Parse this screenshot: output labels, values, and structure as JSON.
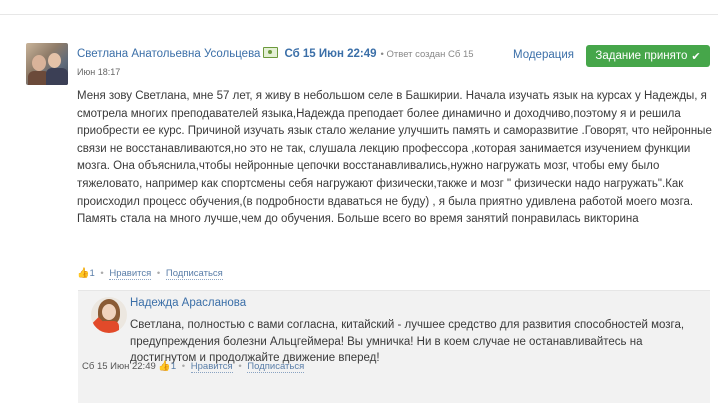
{
  "post": {
    "author": "Светлана Анатольевна Усольцева",
    "date": "Сб 15 Июн 22:49",
    "reply_note": "• Ответ создан Сб 15",
    "time": "Июн 18:17",
    "moderation_label": "Модерация",
    "accepted_label": "Задание принято",
    "text": "Меня зову Светлана, мне 57 лет, я живу в небольшом селе в Башкирии. Начала изучать язык на курсах у Надежды, я смотрела многих преподавателей языка,Надежда преподает более динамично и доходчиво,поэтому я и решила приобрести ее курс. Причиной изучать язык стало желание улучшить память и саморазвитие .Говорят, что нейронные связи не восстанавливаются,но это не так, слушала лекцию профессора ,которая занимается изучением функции мозга. Она объяснила,чтобы нейронные цепочки восстанавливались,нужно нагружать мозг, чтобы ему было тяжеловато, например как спортсмены себя нагружают физически,также и мозг \" физически надо нагружать\".Как происходил процесс обучения,(в подробности вдаваться не буду) , я была приятно удивлена работой моего мозга. Память стала на много лучше,чем до обучения. Больше всего во время занятий понравилась викторина",
    "likes": "1",
    "like_label": "Нравится",
    "subscribe_label": "Подписаться"
  },
  "reply": {
    "author": "Надежда Арасланова",
    "text": "Светлана, полностью с вами согласна, китайский - лучшее средство для развития способностей мозга, предупреждения болезни Альцгеймера! Вы умничка! Ни в коем случае не останавливайтесь на достигнутом и продолжайте движение вперед!",
    "date": "Сб 15 Июн 22:49",
    "likes": "1",
    "like_label": "Нравится",
    "subscribe_label": "Подписаться"
  }
}
